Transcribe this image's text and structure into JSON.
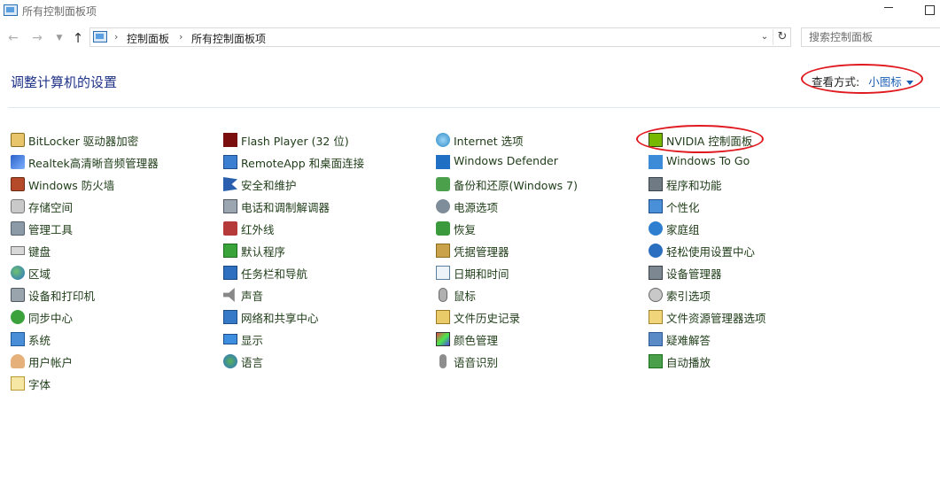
{
  "window": {
    "title": "所有控制面板项"
  },
  "nav": {
    "breadcrumbs": [
      "控制面板",
      "所有控制面板项"
    ],
    "search_placeholder": "搜索控制面板"
  },
  "header": {
    "title": "调整计算机的设置",
    "view_by_label": "查看方式:",
    "view_by_value": "小图标"
  },
  "colors": {
    "annotation": "#e0191f",
    "link": "#1a5fb4",
    "title": "#1e3287"
  },
  "columns": [
    [
      {
        "label": "BitLocker 驱动器加密",
        "icon": "bitlocker-icon"
      },
      {
        "label": "Realtek高清晰音频管理器",
        "icon": "realtek-audio-icon"
      },
      {
        "label": "Windows 防火墙",
        "icon": "firewall-icon"
      },
      {
        "label": "存储空间",
        "icon": "storage-spaces-icon"
      },
      {
        "label": "管理工具",
        "icon": "admin-tools-icon"
      },
      {
        "label": "键盘",
        "icon": "keyboard-icon"
      },
      {
        "label": "区域",
        "icon": "region-icon"
      },
      {
        "label": "设备和打印机",
        "icon": "devices-printers-icon"
      },
      {
        "label": "同步中心",
        "icon": "sync-center-icon"
      },
      {
        "label": "系统",
        "icon": "system-icon"
      },
      {
        "label": "用户帐户",
        "icon": "user-accounts-icon"
      },
      {
        "label": "字体",
        "icon": "fonts-icon"
      }
    ],
    [
      {
        "label": "Flash Player (32 位)",
        "icon": "flash-player-icon"
      },
      {
        "label": "RemoteApp 和桌面连接",
        "icon": "remoteapp-icon"
      },
      {
        "label": "安全和维护",
        "icon": "security-maintenance-icon"
      },
      {
        "label": "电话和调制解调器",
        "icon": "phone-modem-icon"
      },
      {
        "label": "红外线",
        "icon": "infrared-icon"
      },
      {
        "label": "默认程序",
        "icon": "default-programs-icon"
      },
      {
        "label": "任务栏和导航",
        "icon": "taskbar-icon"
      },
      {
        "label": "声音",
        "icon": "sound-icon"
      },
      {
        "label": "网络和共享中心",
        "icon": "network-sharing-icon"
      },
      {
        "label": "显示",
        "icon": "display-icon"
      },
      {
        "label": "语言",
        "icon": "language-icon"
      }
    ],
    [
      {
        "label": "Internet 选项",
        "icon": "internet-options-icon"
      },
      {
        "label": "Windows Defender",
        "icon": "windows-defender-icon"
      },
      {
        "label": "备份和还原(Windows 7)",
        "icon": "backup-restore-icon"
      },
      {
        "label": "电源选项",
        "icon": "power-options-icon"
      },
      {
        "label": "恢复",
        "icon": "recovery-icon"
      },
      {
        "label": "凭据管理器",
        "icon": "credential-manager-icon"
      },
      {
        "label": "日期和时间",
        "icon": "date-time-icon"
      },
      {
        "label": "鼠标",
        "icon": "mouse-icon"
      },
      {
        "label": "文件历史记录",
        "icon": "file-history-icon"
      },
      {
        "label": "颜色管理",
        "icon": "color-management-icon"
      },
      {
        "label": "语音识别",
        "icon": "speech-recognition-icon"
      }
    ],
    [
      {
        "label": "NVIDIA 控制面板",
        "icon": "nvidia-icon"
      },
      {
        "label": "Windows To Go",
        "icon": "windows-to-go-icon"
      },
      {
        "label": "程序和功能",
        "icon": "programs-features-icon"
      },
      {
        "label": "个性化",
        "icon": "personalization-icon"
      },
      {
        "label": "家庭组",
        "icon": "homegroup-icon"
      },
      {
        "label": "轻松使用设置中心",
        "icon": "ease-of-access-icon"
      },
      {
        "label": "设备管理器",
        "icon": "device-manager-icon"
      },
      {
        "label": "索引选项",
        "icon": "indexing-options-icon"
      },
      {
        "label": "文件资源管理器选项",
        "icon": "file-explorer-options-icon"
      },
      {
        "label": "疑难解答",
        "icon": "troubleshooting-icon"
      },
      {
        "label": "自动播放",
        "icon": "autoplay-icon"
      }
    ]
  ]
}
